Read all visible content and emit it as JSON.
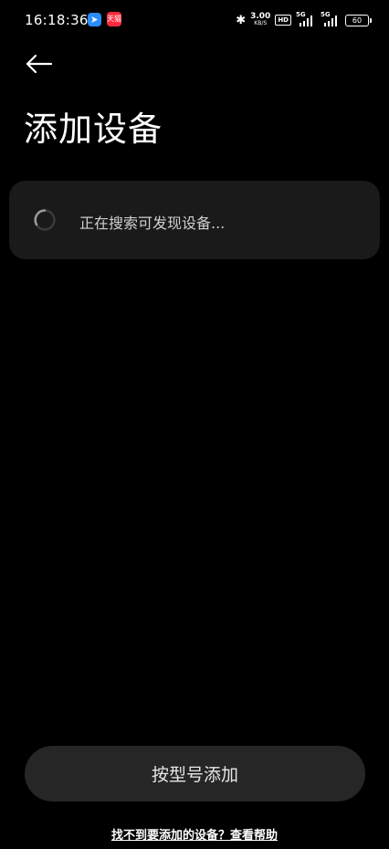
{
  "status_bar": {
    "time": "16:18:36",
    "app_icon_2_label": "天猫",
    "bluetooth": "✱",
    "net_speed": "3.00",
    "net_speed_unit": "KB/S",
    "hd_badge": "HD",
    "sim1_label": "5G",
    "sim2_label": "5G",
    "battery": "60"
  },
  "page": {
    "title": "添加设备"
  },
  "search_card": {
    "status_text": "正在搜索可发现设备..."
  },
  "actions": {
    "add_by_model_label": "按型号添加",
    "help_link_text": "找不到要添加的设备？查看帮助"
  },
  "colors": {
    "background": "#000000",
    "card": "#1a1a1a",
    "button": "#262626"
  }
}
